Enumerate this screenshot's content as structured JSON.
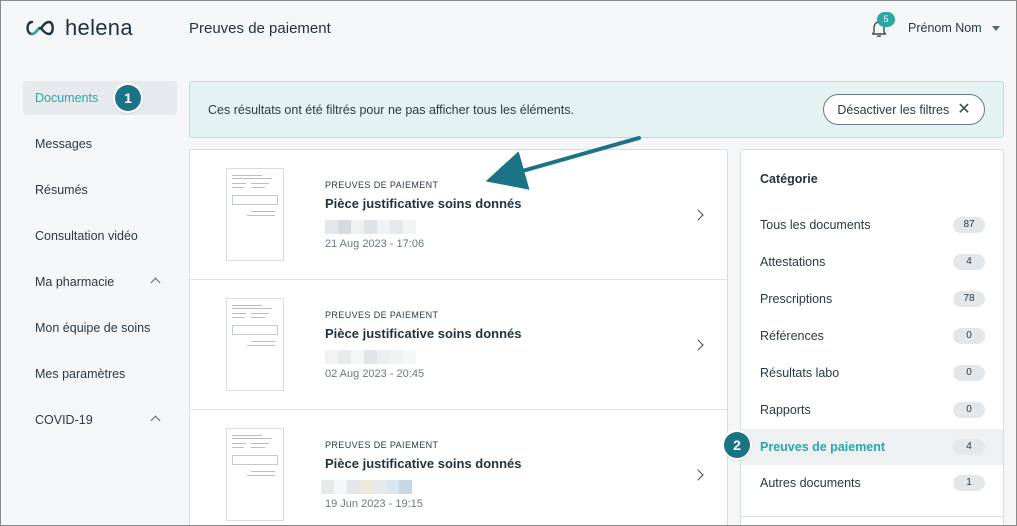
{
  "app": {
    "logo_text": "helena",
    "page_title": "Preuves de paiement",
    "notifications_count": "5",
    "user_name": "Prénom Nom"
  },
  "sidebar": {
    "items": [
      {
        "label": "Documents",
        "active": true
      },
      {
        "label": "Messages"
      },
      {
        "label": "Résumés"
      },
      {
        "label": "Consultation vidéo"
      },
      {
        "label": "Ma pharmacie",
        "expandable": true
      },
      {
        "label": "Mon équipe de soins"
      },
      {
        "label": "Mes paramètres"
      },
      {
        "label": "COVID-19",
        "expandable": true
      }
    ]
  },
  "filter_banner": {
    "message": "Ces résultats ont été filtrés pour ne pas afficher tous les éléments.",
    "button_label": "Désactiver les filtres"
  },
  "documents": [
    {
      "category": "PREUVES DE PAIEMENT",
      "title": "Pièce justificative soins donnés",
      "date": "21 Aug 2023 - 17:06"
    },
    {
      "category": "PREUVES DE PAIEMENT",
      "title": "Pièce justificative soins donnés",
      "date": "02 Aug 2023 - 20:45"
    },
    {
      "category": "PREUVES DE PAIEMENT",
      "title": "Pièce justificative soins donnés",
      "date": "19 Jun 2023 - 19:15"
    }
  ],
  "categories": {
    "heading": "Catégorie",
    "items": [
      {
        "label": "Tous les documents",
        "count": "87"
      },
      {
        "label": "Attestations",
        "count": "4"
      },
      {
        "label": "Prescriptions",
        "count": "78"
      },
      {
        "label": "Références",
        "count": "0"
      },
      {
        "label": "Résultats labo",
        "count": "0"
      },
      {
        "label": "Rapports",
        "count": "0"
      },
      {
        "label": "Preuves de paiement",
        "count": "4",
        "active": true
      },
      {
        "label": "Autres documents",
        "count": "1"
      }
    ]
  },
  "annotations": {
    "step1": "1",
    "step2": "2"
  },
  "colors": {
    "accent": "#2aa7a6",
    "annotation": "#1b7486",
    "banner_bg": "#e4f3f2"
  }
}
